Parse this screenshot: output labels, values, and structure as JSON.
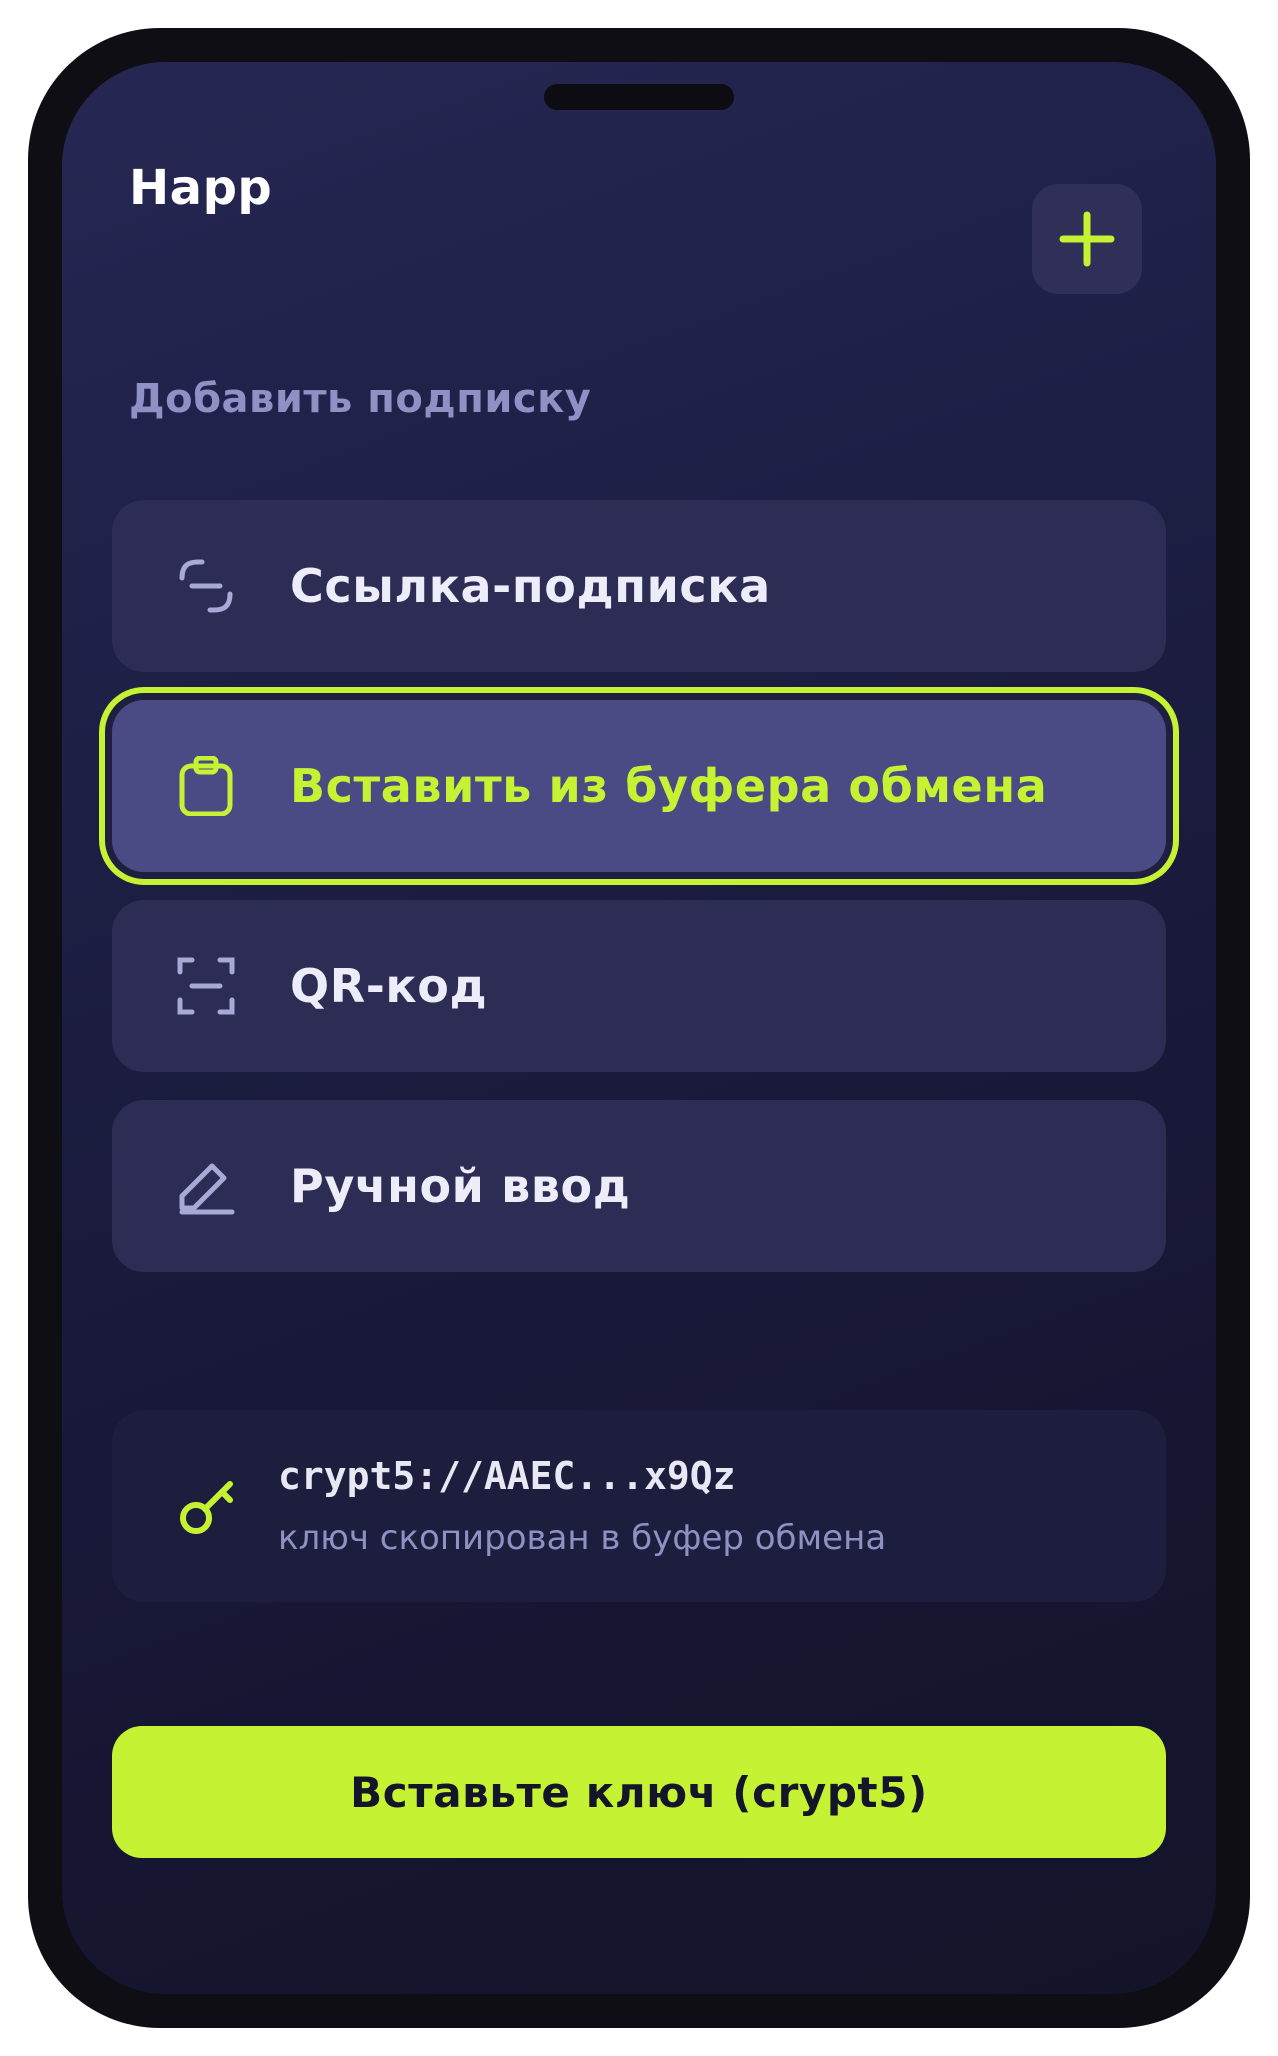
{
  "app": {
    "title": "Happ"
  },
  "header": {
    "add_icon": "plus-icon"
  },
  "section": {
    "title": "Добавить подписку"
  },
  "options": [
    {
      "label": "Ссылка-подписка",
      "icon": "link-icon",
      "selected": false
    },
    {
      "label": "Вставить из буфера обмена",
      "icon": "clipboard-icon",
      "selected": true
    },
    {
      "label": "QR-код",
      "icon": "qr-scan-icon",
      "selected": false
    },
    {
      "label": "Ручной ввод",
      "icon": "pencil-icon",
      "selected": false
    }
  ],
  "key_card": {
    "icon": "key-icon",
    "value": "crypt5://AAEC...x9Qz",
    "status": "ключ скопирован в буфер обмена"
  },
  "cta": {
    "label": "Вставьте ключ (crypt5)"
  },
  "colors": {
    "accent": "#c5f232",
    "background": "#1d1f45",
    "card": "#2c2c54",
    "selected_card": "#4a4a85",
    "muted_text": "#8f90c4"
  }
}
